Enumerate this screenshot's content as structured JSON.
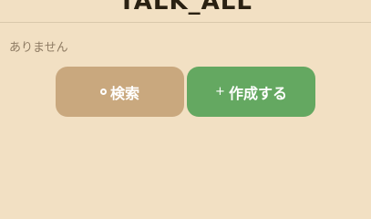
{
  "header": {
    "title": "TALK_ALL"
  },
  "content": {
    "empty_message": "ありません"
  },
  "buttons": {
    "search": {
      "label": "検索",
      "icon": "ring-icon"
    },
    "create": {
      "label": "作成する",
      "icon": "plus-icon",
      "icon_glyph": "+"
    }
  },
  "colors": {
    "background": "#f2e0c3",
    "search_button": "#c9a87e",
    "create_button": "#64a861",
    "title_text": "#2a2112",
    "muted_text": "#8e7b63"
  }
}
